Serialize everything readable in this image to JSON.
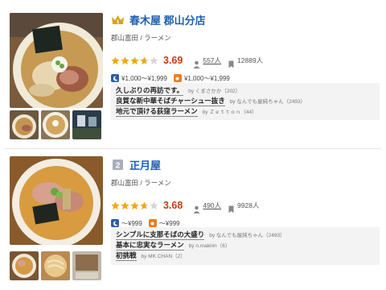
{
  "restaurants": [
    {
      "name": "春木屋 郡山分店",
      "area_genre": "郡山富田 / ラーメン",
      "rating": "3.69",
      "rating_stars": 3.69,
      "reviews_count": "557人",
      "bookmarks": "12889人",
      "price_night": "¥1,000～¥1,999",
      "price_day": "¥1,000～¥1,999",
      "reviews": [
        {
          "title": "久しぶりの再訪です。",
          "by": "by くまさかか（202）"
        },
        {
          "title": "良質な新中華そばチャーシュー抜き",
          "by": "by なんでも屋純ちゃん（2493）"
        },
        {
          "title": "地元で頂ける荻窪ラーメン",
          "by": "by Ｚｅｔｔｏｎ（44）"
        }
      ]
    },
    {
      "name": "正月屋",
      "area_genre": "郡山富田 / ラーメン",
      "rating": "3.68",
      "rating_stars": 3.68,
      "reviews_count": "490人",
      "bookmarks": "9928人",
      "price_night": "～¥999",
      "price_day": "～¥999",
      "reviews": [
        {
          "title": "シンプルに支那そばの大盛り",
          "by": "by なんでも屋純ちゃん（2493）"
        },
        {
          "title": "基本に忠実なラーメン",
          "by": "by n.makirin（6）"
        },
        {
          "title": "初挑戦",
          "by": "by MK CHAN（2）"
        }
      ]
    }
  ],
  "colors": {
    "title": "#1f5fb0",
    "score": "#d03a0b",
    "star": "#f0a900",
    "night_badge": "#2d5ea6",
    "day_badge": "#ef7d1a"
  },
  "icons": {
    "rank1": "crown-rank-1-icon",
    "rank2": "rank-2-icon",
    "reviewer": "person-icon",
    "bookmark": "bookmark-icon"
  }
}
